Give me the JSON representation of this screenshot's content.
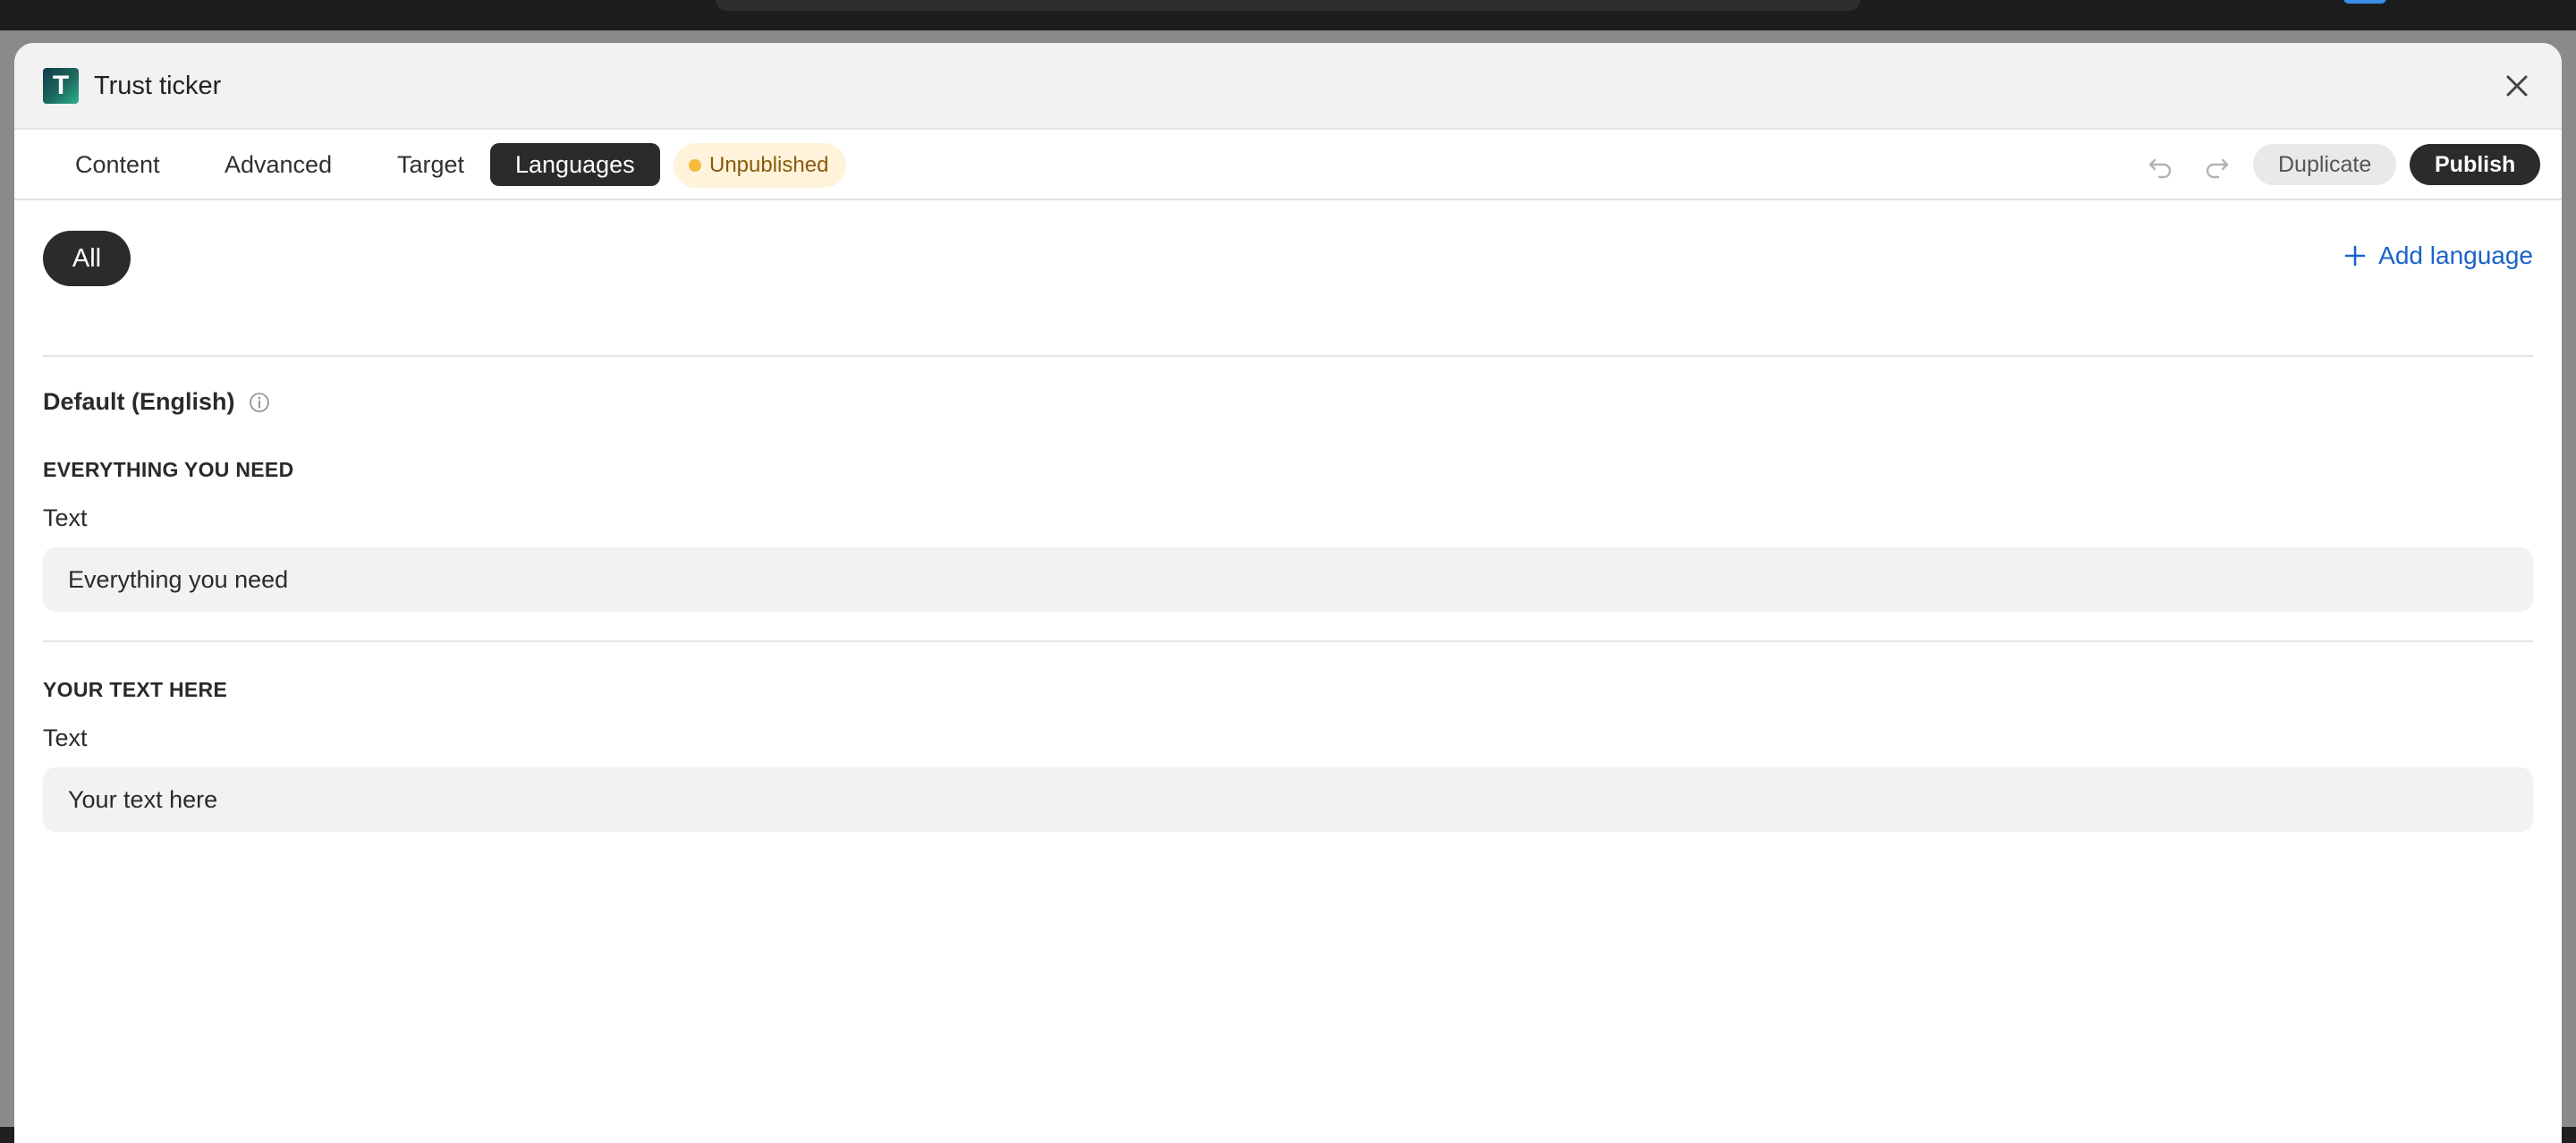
{
  "window": {
    "title": "Trust ticker",
    "logo_letter": "T"
  },
  "tabs": [
    {
      "label": "Content"
    },
    {
      "label": "Advanced"
    },
    {
      "label": "Target"
    },
    {
      "label": "Languages",
      "active": true
    }
  ],
  "status": {
    "label": "Unpublished",
    "color": "#f6bb3a"
  },
  "toolbar": {
    "duplicate_label": "Duplicate",
    "publish_label": "Publish"
  },
  "filter": {
    "all_label": "All"
  },
  "add_language_label": "Add language",
  "default_language_label": "Default (English)",
  "sections": [
    {
      "heading": "EVERYTHING YOU NEED",
      "field_label": "Text",
      "value": "Everything you need"
    },
    {
      "heading": "YOUR TEXT HERE",
      "field_label": "Text",
      "value": "Your text here"
    }
  ],
  "colors": {
    "accent_dark": "#2b2b2b",
    "link_blue": "#1a62c9",
    "status_bg": "#fff3dc"
  }
}
